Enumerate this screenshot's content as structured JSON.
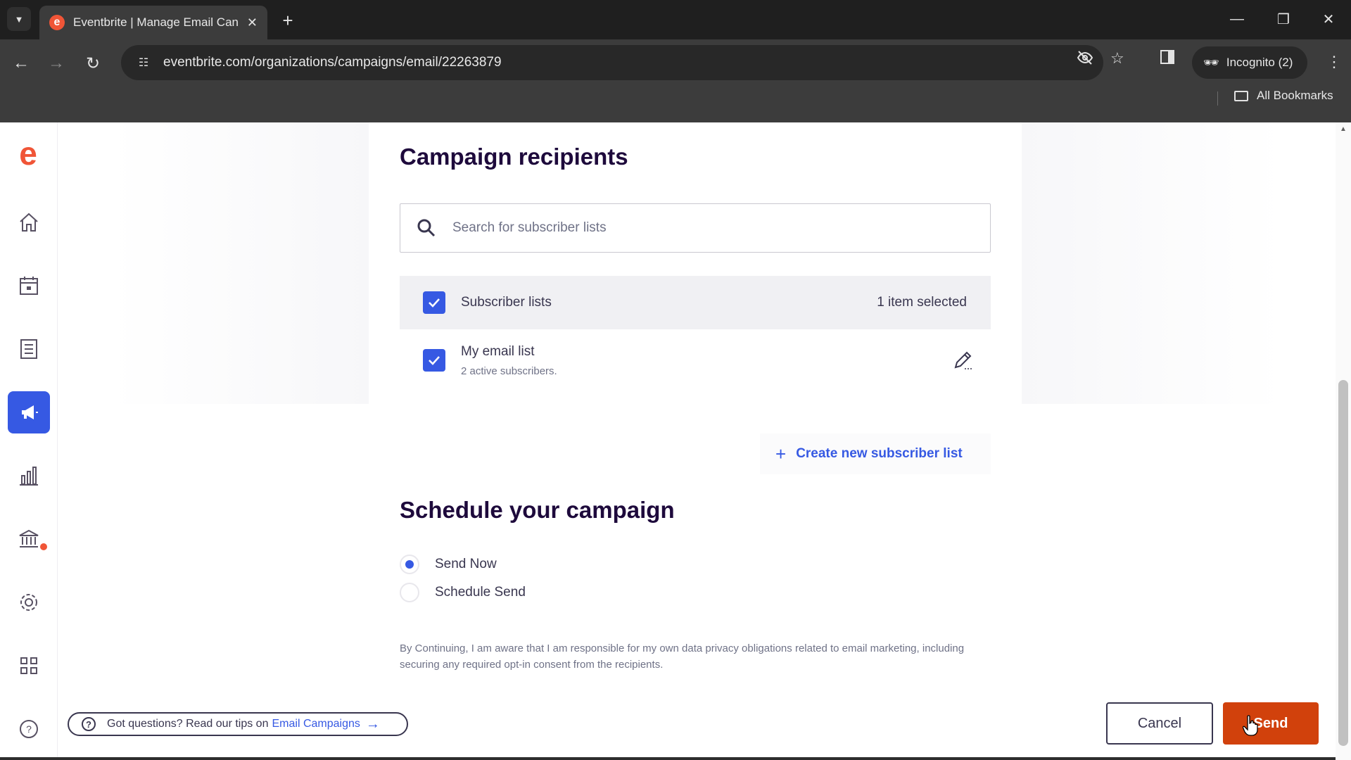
{
  "browser": {
    "tab_title": "Eventbrite | Manage Email Can",
    "favicon_letter": "e",
    "url": "eventbrite.com/organizations/campaigns/email/22263879",
    "incognito_label": "Incognito (2)",
    "bookmarks_label": "All Bookmarks"
  },
  "sidebar": {
    "logo": "e",
    "items": [
      {
        "name": "home-icon"
      },
      {
        "name": "calendar-icon"
      },
      {
        "name": "orders-icon"
      },
      {
        "name": "marketing-icon",
        "active": true
      },
      {
        "name": "reports-icon"
      },
      {
        "name": "finance-icon",
        "notification": true
      },
      {
        "name": "settings-icon"
      },
      {
        "name": "apps-icon"
      },
      {
        "name": "help-icon"
      }
    ]
  },
  "recipients": {
    "heading": "Campaign recipients",
    "search_placeholder": "Search for subscriber lists",
    "header_label": "Subscriber lists",
    "header_count": "1 item selected",
    "list": {
      "name": "My email list",
      "subscribers": "2 active subscribers."
    },
    "create_label": "Create new subscriber list"
  },
  "schedule": {
    "heading": "Schedule your campaign",
    "options": [
      {
        "label": "Send Now",
        "selected": true
      },
      {
        "label": "Schedule Send",
        "selected": false
      }
    ]
  },
  "disclaimer": "By Continuing, I am aware that I am responsible for my own data privacy obligations related to email marketing, including securing any required opt-in consent from the recipients.",
  "footer": {
    "help_text": "Got questions? Read our tips on",
    "help_link": "Email Campaigns",
    "cancel_label": "Cancel",
    "send_label": "Send"
  },
  "colors": {
    "accent": "#3659e3",
    "brand": "#f05537",
    "send": "#d1410c"
  }
}
